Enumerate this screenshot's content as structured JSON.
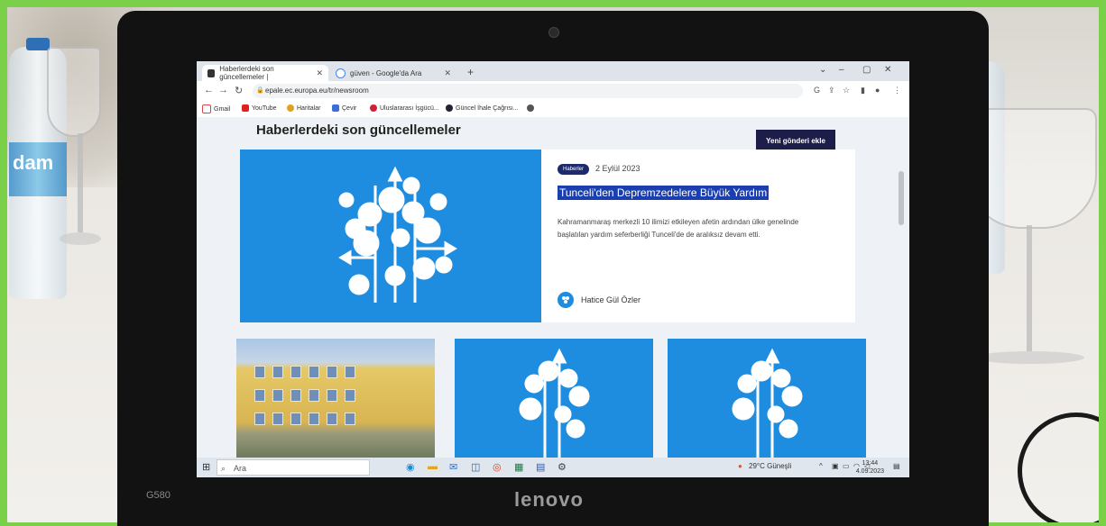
{
  "browser": {
    "tabs": [
      {
        "label": "Haberlerdeki son güncellemeler |"
      },
      {
        "label": "güven - Google'da Ara"
      }
    ],
    "url": "epale.ec.europa.eu/tr/newsroom",
    "bookmarks": [
      "Gmail",
      "YouTube",
      "Haritalar",
      "Çevir",
      "Uluslararası İşgücü...",
      "Güncel İhale Çağrısı..."
    ]
  },
  "page": {
    "title": "Haberlerdeki son güncellemeler",
    "new_post_label": "Yeni gönderi ekle",
    "featured": {
      "badge": "Haberler",
      "date": "2 Eylül 2023",
      "headline": "Tunceli'den Depremzedelere Büyük Yardım",
      "excerpt": "Kahramanmaraş merkezli 10 ilimizi etkileyen afetin ardından ülke genelinde başlatılan yardım seferberliği Tunceli'de de aralıksız devam etti.",
      "author": "Hatice Gül Özler"
    }
  },
  "taskbar": {
    "search_placeholder": "Ara",
    "weather": "29°C Güneşli",
    "time": "13:44",
    "date": "4.09.2023"
  },
  "laptop": {
    "brand": "lenovo",
    "model": "G580"
  },
  "bottle_label": "dam",
  "colors": {
    "frame": "#7bd04a",
    "accent_blue": "#1e8de0",
    "button_dark": "#1d1d4a",
    "highlight": "#1c3fb0"
  }
}
